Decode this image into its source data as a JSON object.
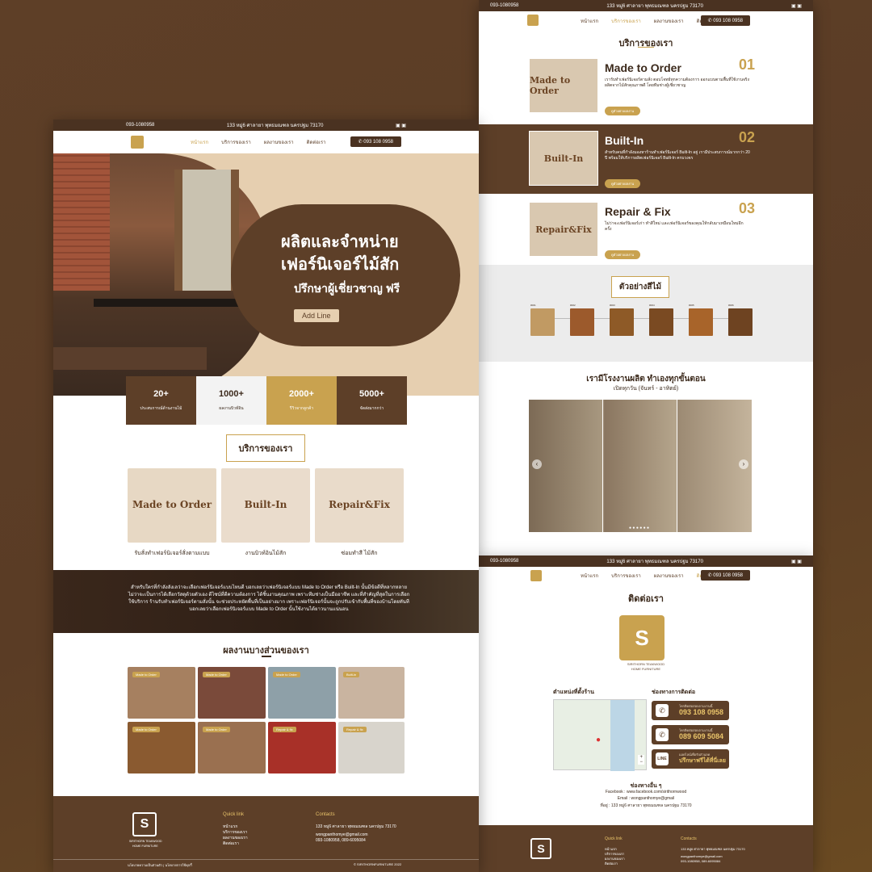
{
  "colors": {
    "brown": "#5d3f28",
    "dark_brown": "#4a3221",
    "gold": "#c9a24f",
    "beige": "#e6cfb0"
  },
  "left": {
    "topbar": {
      "phone": "093-1080958",
      "address": "133 หมู่6 ศาลายา พุทธมณฑล นครปฐม 73170"
    },
    "nav": {
      "items": [
        "หน้าแรก",
        "บริการของเรา",
        "ผลงานของเรา",
        "ติดต่อเรา"
      ],
      "call_button": "093 108 0958"
    },
    "hero": {
      "line1": "ผลิตและจำหน่าย",
      "line2": "เฟอร์นิเจอร์ไม้สัก",
      "line3": "ปรึกษาผู้เชี่ยวชาญ ฟรี",
      "button": "Add Line"
    },
    "stats": [
      {
        "value": "20+",
        "label": "ประสบการณ์ด้านงานไม้"
      },
      {
        "value": "1000+",
        "label": "ผลงานบิวท์อิน"
      },
      {
        "value": "2000+",
        "label": "รีวิวจากลูกค้า"
      },
      {
        "value": "5000+",
        "label": "จัดส่งมากกว่า"
      }
    ],
    "services_title": "บริการของเรา",
    "services": [
      {
        "name": "Made to Order",
        "caption": "รับสั่งทำเฟอร์นิเจอร์สั่งตามแบบ"
      },
      {
        "name": "Built-In",
        "caption": "งานบิวท์อินไม้สัก"
      },
      {
        "name": "Repair&Fix",
        "caption": "ซ่อมทำสี ไม้สัก"
      }
    ],
    "banner_text": "สำหรับใครที่กำลังลังเลว่าจะเลือกเฟอร์นิเจอร์แบบไหนดี บอกเลยว่าเฟอร์นิเจอร์แบบ Made to Order หรือ Built-In นั้นมีข้อดีที่หลากหลาย ไม่ว่าจะเป็นการได้เลือกวัสดุด้วยตัวเอง ดีไซน์ที่ตีความต้องการ ได้ชิ้นงานคุณภาพ เพราะทีมช่างเป็นมืออาชีพ และที่สำคัญที่สุดในการเลือกใช้บริการ ร้านรับทำเฟอร์นิเจอร์ตามสั่งนั้น จะช่วยประหยัดพื้นที่เป็นอย่างมาก เพราะเฟอร์นิเจอร์นั้นจะถูกปรับเข้ากับพื้นที่ของบ้านโดยทันที บอกเลยว่าเลือกเฟอร์นิเจอร์แบบ Made to Order นั้นใช้งานได้ยาวนานแน่นอน",
    "portfolio_title": "ผลงานบางส่วนของเรา",
    "portfolio_tags": [
      "Made to Order",
      "Made to Order",
      "Made to Order",
      "Built-in",
      "Made to Order",
      "Made to Order",
      "Repair & fix",
      "Repair & fix"
    ],
    "footer": {
      "brand1": "SIRITHORN TEAKWOOD",
      "brand2": "HOME FURNITURE",
      "quick_title": "Quick link",
      "quick": [
        "หน้าแรก",
        "บริการของเรา",
        "ผลงานของเรา",
        "ติดต่อเรา"
      ],
      "contacts_title": "Contacts",
      "address": "133 หมู่6 ศาลายา พุทธมณฑล นครปฐม 73170",
      "email": "wongpanthomye@gmail.com",
      "phones": "093-1080958, 089-6095084",
      "bottom_left": "นโยบายความเป็นส่วนตัว | นโยบายการใช้คุกกี้",
      "bottom_right": "© SIRITHORNFURNITURE 2022"
    }
  },
  "right": {
    "topbar": {
      "phone": "093-1080958",
      "address": "133 หมู่6 ศาลายา พุทธมณฑล นครปฐม 73170"
    },
    "nav": {
      "items": [
        "หน้าแรก",
        "บริการของเรา",
        "ผลงานของเรา",
        "ติดต่อเรา"
      ],
      "call_button": "093 108 0958"
    },
    "services_title": "บริการของเรา",
    "services": [
      {
        "title": "Made to Order",
        "num": "01",
        "img": "Made to Order",
        "text": "เรารับทำเฟอร์นิเจอร์ตามสั่ง ตอบโจทย์ทุกความต้องการ ออกแบบตามพื้นที่ใช้งานจริง ผลิตจากไม้สักคุณภาพดี โดยทีมช่างผู้เชี่ยวชาญ",
        "button": "ดูตัวอย่างผลงาน"
      },
      {
        "title": "Built-In",
        "num": "02",
        "img": "Built-In",
        "text": "สำหรับคนที่กำลังมองหาร้านทำเฟอร์นิเจอร์ Built-In อยู่ เรามีประสบการณ์มากกว่า 20 ปี พร้อมให้บริการผลิตเฟอร์นิเจอร์ Built-In ครบวงจร",
        "button": "ดูตัวอย่างผลงาน"
      },
      {
        "title": "Repair & Fix",
        "num": "03",
        "img": "Repair&Fix",
        "text": "ไม่ว่าจะเฟอร์นิเจอร์เก่า ทำสีใหม่ และเฟอร์นิเจอร์ของคุณให้กลับมาเหมือนใหม่อีกครั้ง",
        "button": "ดูตัวอย่างผลงาน"
      }
    ],
    "wood_title": "ตัวอย่างสีไม้",
    "wood_codes": [
      "#001",
      "#002",
      "#003",
      "#004",
      "#005",
      "#006"
    ],
    "factory_title": "เรามีโรงงานผลิต ทำเองทุกขั้นตอน",
    "factory_sub": "เปิดทุกวัน (จันทร์ - อาทิตย์)",
    "contact_title": "ติดต่อเรา",
    "brand1": "SIRITHORN TEAKWOOD",
    "brand2": "HOME FURNITURE",
    "location_title": "ตำแหน่งที่ตั้งร้าน",
    "channels_title": "ช่องทางการติดต่อ",
    "contacts": [
      {
        "label": "โทรติดต่อสอบถามงานนี้",
        "value": "093 108 0958"
      },
      {
        "label": "โทรติดต่อสอบถามงานนี้",
        "value": "089 609 5084"
      },
      {
        "label": "แอดไลน์เพื่อรับส่วนลด",
        "value": "ปรึกษาฟรีได้ที่นี่เลย"
      }
    ],
    "other_title": "ช่องทางอื่น ๆ",
    "facebook": "Facebook : www.facebook.com/sirithornwood",
    "email": "Email : wongpanthomye@gmail",
    "address_line": "ที่อยู่ : 133 หมู่6 ศาลายา พุทธมณฑล นครปฐม 73170",
    "footer": {
      "quick_title": "Quick link",
      "quick": [
        "หน้าแรก",
        "บริการของเรา",
        "ผลงานของเรา",
        "ติดต่อเรา"
      ],
      "contacts_title": "Contacts",
      "address": "133 หมู่6 ศาลายา พุทธมณฑล นครปฐม 73170",
      "email": "wongpanthomye@gmail.com",
      "phones": "093-1080958, 089-6095084"
    }
  }
}
